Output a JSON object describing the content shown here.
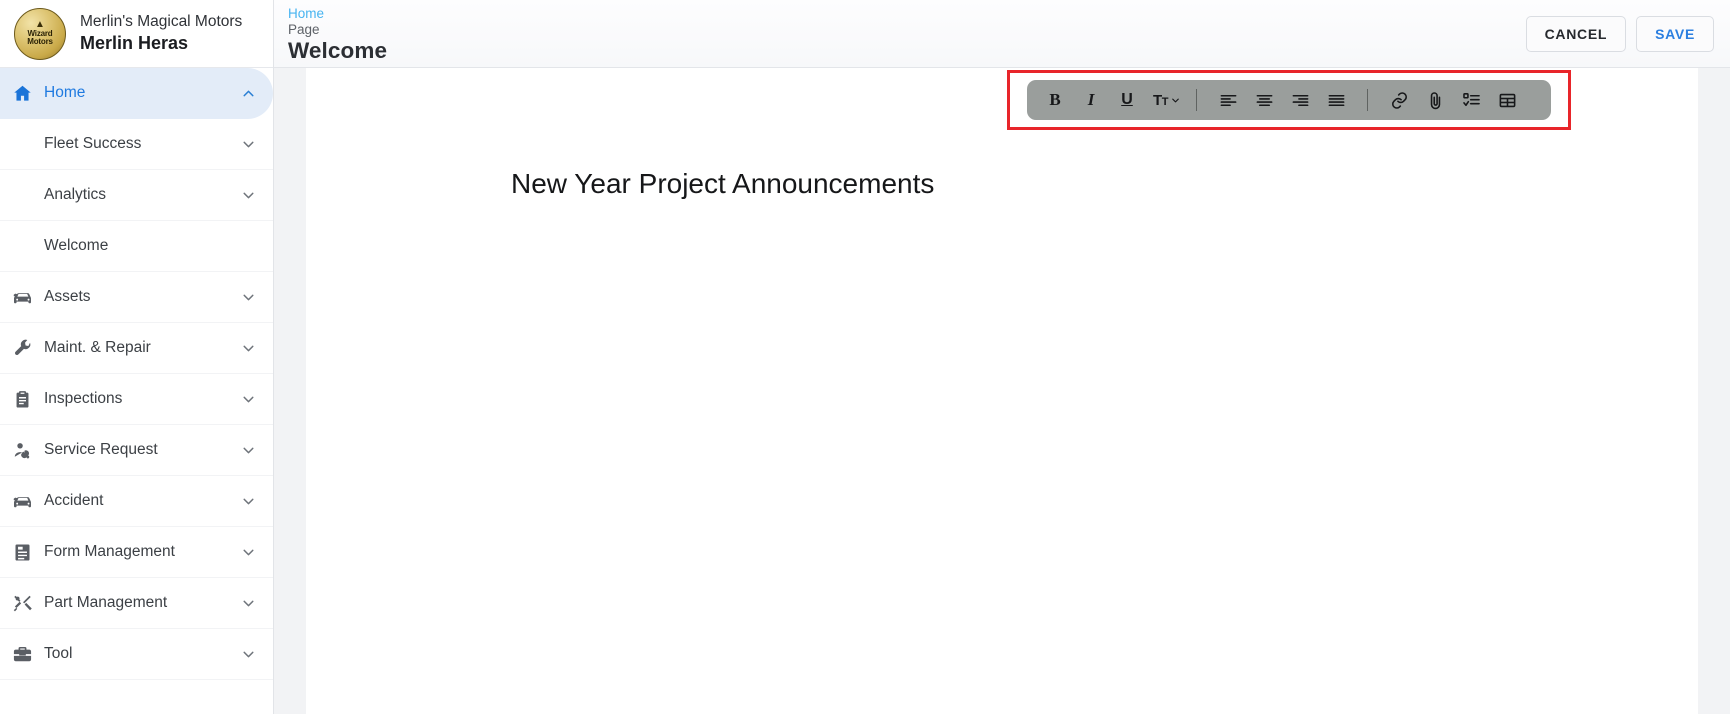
{
  "brand": {
    "company": "Merlin's Magical Motors",
    "user": "Merlin Heras",
    "logo_line1": "Wizard",
    "logo_line2": "Motors",
    "logo_icon": "wizard-hat-icon"
  },
  "sidebar": {
    "items": [
      {
        "label": "Home",
        "icon": "home-icon",
        "active": true,
        "chevron": "up",
        "sub": false
      },
      {
        "label": "Fleet Success",
        "icon": "none",
        "active": false,
        "chevron": "down",
        "sub": true
      },
      {
        "label": "Analytics",
        "icon": "none",
        "active": false,
        "chevron": "down",
        "sub": true
      },
      {
        "label": "Welcome",
        "icon": "none",
        "active": false,
        "chevron": "none",
        "sub": true
      },
      {
        "label": "Assets",
        "icon": "car-icon",
        "active": false,
        "chevron": "down",
        "sub": false
      },
      {
        "label": "Maint. & Repair",
        "icon": "wrench-icon",
        "active": false,
        "chevron": "down",
        "sub": false
      },
      {
        "label": "Inspections",
        "icon": "clipboard-icon",
        "active": false,
        "chevron": "down",
        "sub": false
      },
      {
        "label": "Service Request",
        "icon": "person-wrench-icon",
        "active": false,
        "chevron": "down",
        "sub": false
      },
      {
        "label": "Accident",
        "icon": "car-icon",
        "active": false,
        "chevron": "down",
        "sub": false
      },
      {
        "label": "Form Management",
        "icon": "document-icon",
        "active": false,
        "chevron": "down",
        "sub": false
      },
      {
        "label": "Part Management",
        "icon": "tools-icon",
        "active": false,
        "chevron": "down",
        "sub": false
      },
      {
        "label": "Tool",
        "icon": "toolbox-icon",
        "active": false,
        "chevron": "down",
        "sub": false
      }
    ]
  },
  "header": {
    "breadcrumb_home": "Home",
    "breadcrumb_kind": "Page",
    "title": "Welcome",
    "cancel_label": "CANCEL",
    "save_label": "SAVE"
  },
  "editor": {
    "document_title": "New Year Project Announcements",
    "toolbar": {
      "highlighted": true,
      "highlight_color": "#e8252a",
      "background_color": "#9a9e9c",
      "buttons": [
        {
          "name": "bold-icon",
          "label": "B",
          "type": "text"
        },
        {
          "name": "italic-icon",
          "label": "I",
          "type": "text"
        },
        {
          "name": "underline-icon",
          "label": "U",
          "type": "text"
        },
        {
          "name": "font-size-icon",
          "label": "Tт",
          "type": "text"
        },
        {
          "name": "separator",
          "label": "",
          "type": "sep"
        },
        {
          "name": "align-left-icon",
          "label": "",
          "type": "svg"
        },
        {
          "name": "align-center-icon",
          "label": "",
          "type": "svg"
        },
        {
          "name": "align-right-icon",
          "label": "",
          "type": "svg"
        },
        {
          "name": "align-justify-icon",
          "label": "",
          "type": "svg"
        },
        {
          "name": "separator",
          "label": "",
          "type": "sep"
        },
        {
          "name": "link-icon",
          "label": "",
          "type": "svg"
        },
        {
          "name": "attachment-icon",
          "label": "",
          "type": "svg"
        },
        {
          "name": "checklist-icon",
          "label": "",
          "type": "svg"
        },
        {
          "name": "table-icon",
          "label": "",
          "type": "svg"
        }
      ]
    }
  },
  "colors": {
    "accent_blue": "#1f7ae0",
    "breadcrumb_blue": "#47b4f0",
    "active_bg": "#e3ecf8",
    "highlight_red": "#e8252a",
    "toolbar_gray": "#9a9e9c",
    "canvas_gray": "#f2f3f5"
  }
}
